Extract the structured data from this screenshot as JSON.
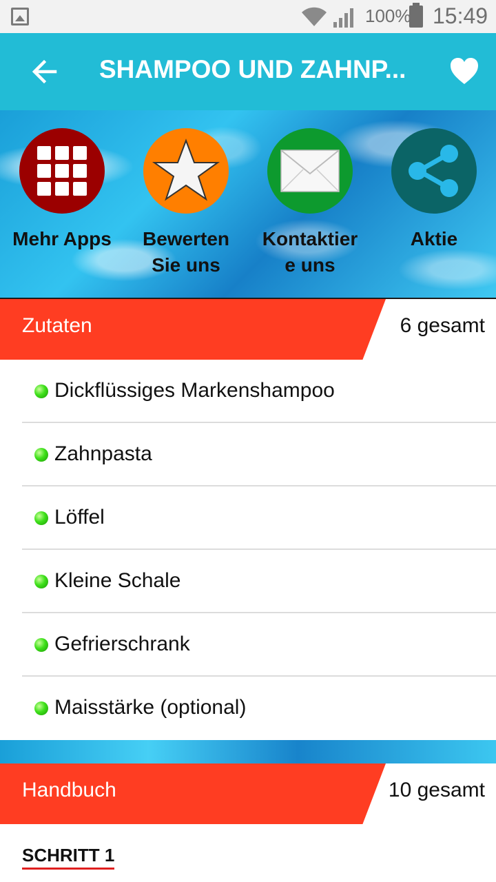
{
  "status_bar": {
    "battery_percent": "100%",
    "time": "15:49"
  },
  "app_bar": {
    "title": "SHAMPOO UND ZAHNP...",
    "back_icon": "arrow-left-icon",
    "favorite_icon": "heart-icon"
  },
  "actions": [
    {
      "label_line1": "Mehr Apps",
      "label_line2": "",
      "color": "#9b0000",
      "icon": "grid-icon"
    },
    {
      "label_line1": "Bewerten",
      "label_line2": "Sie uns",
      "color": "#ff7f00",
      "icon": "star-icon"
    },
    {
      "label_line1": "Kontaktier",
      "label_line2": "e uns",
      "color": "#0d9a2e",
      "icon": "mail-icon"
    },
    {
      "label_line1": "Aktie",
      "label_line2": "",
      "color": "#0b6466",
      "icon": "share-icon"
    }
  ],
  "ingredients_section": {
    "title": "Zutaten",
    "count": "6 gesamt",
    "items": [
      "Dickflüssiges Markenshampoo",
      "Zahnpasta",
      "Löffel",
      "Kleine Schale",
      "Gefrierschrank",
      "Maisstärke (optional)"
    ]
  },
  "manual_section": {
    "title": "Handbuch",
    "count": "10 gesamt",
    "step_label": "SCHRITT 1"
  },
  "colors": {
    "accent": "#22bcd6",
    "section_red": "#ff3d22",
    "bullet_green": "#3ee01a"
  }
}
